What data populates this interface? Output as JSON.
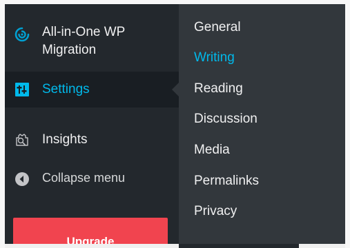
{
  "sidebar": {
    "items": [
      {
        "label": "All-in-One WP\nMigration",
        "icon": "migration-icon"
      },
      {
        "label": "Settings",
        "icon": "settings-icon",
        "active": true
      },
      {
        "label": "Insights",
        "icon": "insights-icon"
      },
      {
        "label": "Collapse menu",
        "icon": "collapse-arrow-icon"
      }
    ],
    "upgrade_label": "Upgrade"
  },
  "submenu": {
    "items": [
      {
        "label": "General"
      },
      {
        "label": "Writing",
        "current": true
      },
      {
        "label": "Reading"
      },
      {
        "label": "Discussion"
      },
      {
        "label": "Media"
      },
      {
        "label": "Permalinks"
      },
      {
        "label": "Privacy"
      }
    ]
  },
  "colors": {
    "sidebar_bg": "#23282d",
    "submenu_bg": "#32373c",
    "active_bg": "#191e23",
    "accent": "#00b9eb",
    "upgrade": "#f1444f"
  }
}
